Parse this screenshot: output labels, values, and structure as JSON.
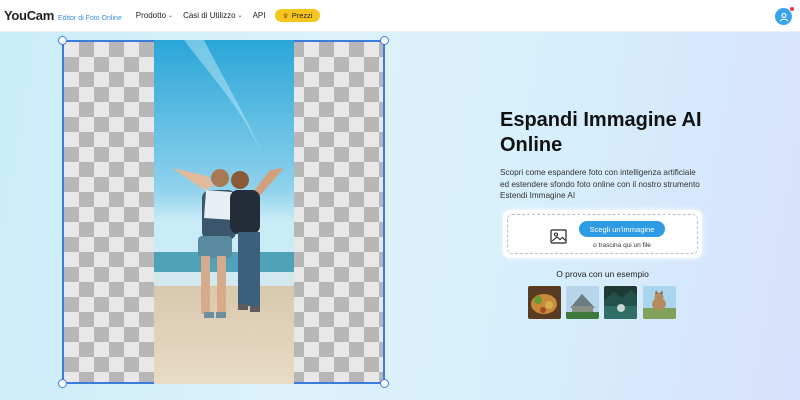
{
  "header": {
    "logo_text": "YouCam",
    "logo_sub": "Editor di Foto Online",
    "nav": [
      {
        "label": "Prodotto",
        "has_dropdown": true
      },
      {
        "label": "Casi di Utilizzo",
        "has_dropdown": true
      },
      {
        "label": "API",
        "has_dropdown": false
      }
    ],
    "pricing_label": "Prezzi",
    "pricing_icon": "crown-icon",
    "avatar_icon": "user-icon"
  },
  "hero": {
    "title": "Espandi Immagine AI Online",
    "description": "Scopri come espandere foto con intelligenza artificiale ed estendere sfondo foto online con il nostro strumento Estendi Immagine AI"
  },
  "upload": {
    "button_label": "Scegli un'immagine",
    "drag_text": "o trascina qui un file",
    "icon": "image-icon"
  },
  "examples": {
    "label": "O prova con un esempio",
    "items": [
      "example-food",
      "example-temple",
      "example-lake",
      "example-cat"
    ]
  },
  "colors": {
    "accent": "#2e9ce4",
    "selection_border": "#3b7ddd",
    "pricing": "#f7c51d"
  }
}
